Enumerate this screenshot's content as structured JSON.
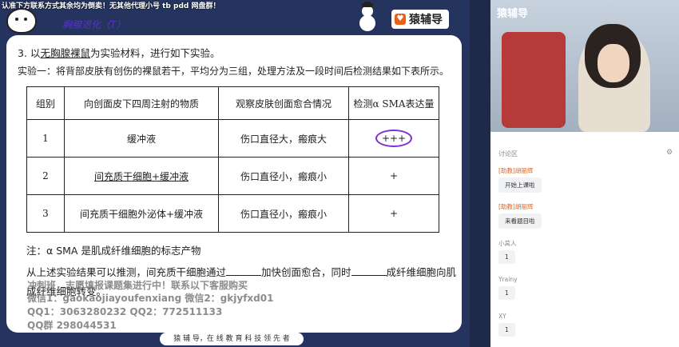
{
  "watermark_top": "认准下方联系方式其余均为倒卖！无其他代理小号 tb pdd 网盘群！",
  "brand": {
    "logo": "♥",
    "name": "猿辅导"
  },
  "handwritten_note": "胸腺退化（T）",
  "question": {
    "number": "3.",
    "pre": "以",
    "underlined": "无胸腺裸鼠",
    "post": "为实验材料，进行如下实验。"
  },
  "experiment1": "实验一：将背部皮肤有创伤的裸鼠若干，平均分为三组，处理方法及一段时间后检测结果如下表所示。",
  "table": {
    "headers": [
      "组别",
      "向创面皮下四周注射的物质",
      "观察皮肤创面愈合情况",
      "检测α SMA表达量"
    ],
    "rows": [
      [
        "1",
        "缓冲液",
        "伤口直径大，瘢痕大",
        "+++"
      ],
      [
        "2",
        "间充质干细胞+缓冲液",
        "伤口直径小，瘢痕小",
        "+"
      ],
      [
        "3",
        "间充质干细胞外泌体+缓冲液",
        "伤口直径小，瘢痕小",
        "+"
      ]
    ]
  },
  "note": "注：α SMA 是肌成纤维细胞的标志产物",
  "conclusion": {
    "part1": "从上述实验结果可以推测，间充质干细胞通过",
    "part2": "加快创面愈合，同时",
    "part3": "成纤维细胞向肌成纤维细胞转变。"
  },
  "watermarks": [
    "冲刺班，志愿填报课题集进行中！联系以下客服购买",
    "微信1：gaokaojiayoufenxiang 微信2：gkjyfxd01",
    "QQ1：3063280232 QQ2：772511133",
    "QQ群 298044531"
  ],
  "footer": "猿 辅 导，在 线 教 育 科 技 领 先 者",
  "video": {
    "brand": "猿辅导"
  },
  "chat": {
    "title": "讨论区",
    "messages": [
      {
        "name": "[助教]胡丽辉",
        "text": "开始上课啦",
        "staff": true
      },
      {
        "name": "[助教]胡丽辉",
        "text": "来看题目啦",
        "staff": true
      },
      {
        "name": "小莴人",
        "text": "1",
        "staff": false
      },
      {
        "name": "Yrainy",
        "text": "1",
        "staff": false
      },
      {
        "name": "XY",
        "text": "1",
        "staff": false
      }
    ]
  }
}
